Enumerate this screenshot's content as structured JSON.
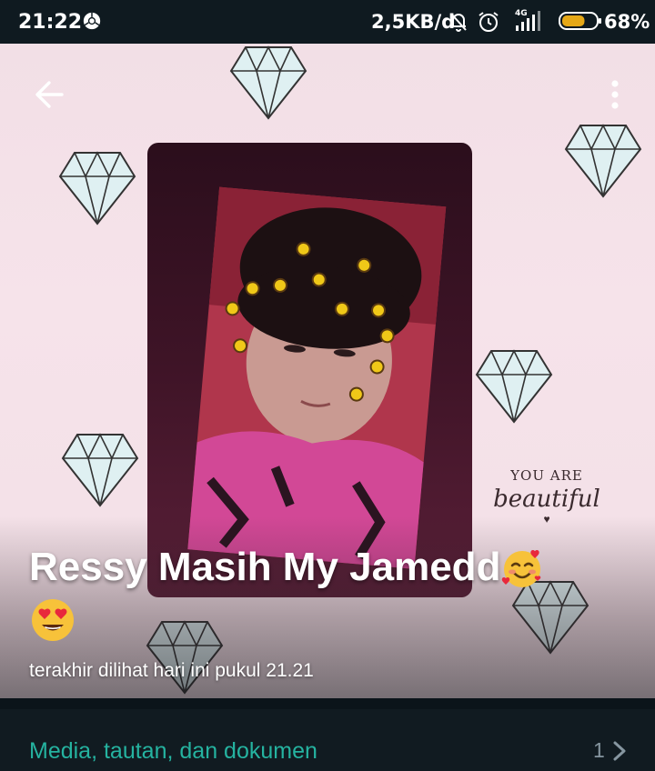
{
  "status_bar": {
    "time": "21:22",
    "network_speed": "2,5KB/d",
    "network_type": "4G",
    "battery_percent": "68%",
    "battery_level": 0.68,
    "icons": [
      "chrome-icon",
      "do-not-disturb-icon",
      "alarm-icon",
      "signal-icon",
      "battery-icon"
    ]
  },
  "profile": {
    "name": "Ressy Masih My Jamedd",
    "name_emojis": [
      "smiling-face-with-hearts-emoji",
      "heart-eyes-emoji"
    ],
    "last_seen": "terakhir dilihat hari ini pukul 21.21",
    "quote_top": "YOU ARE",
    "quote_bottom": "beautiful"
  },
  "media": {
    "label": "Media, tautan, dan dokumen",
    "count": "1"
  },
  "colors": {
    "accent_teal": "#25b3a0",
    "background_dark": "#111b21",
    "profile_pink": "#f2dfe6"
  }
}
